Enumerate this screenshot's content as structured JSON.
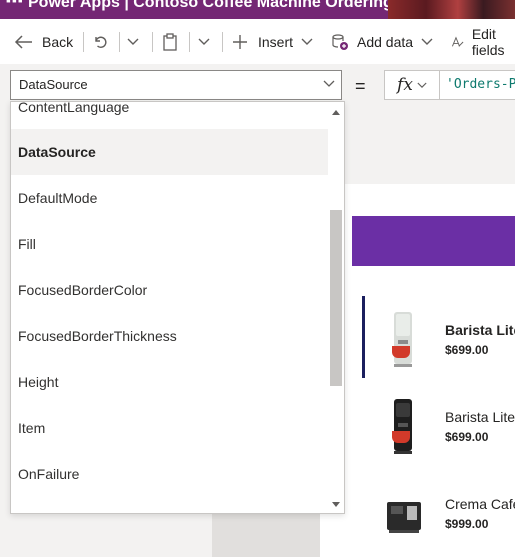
{
  "titlebar": {
    "title": "Power Apps | Contoso Coffee Machine Ordering"
  },
  "commandbar": {
    "back_label": "Back",
    "insert_label": "Insert",
    "add_data_label": "Add data",
    "edit_fields_label": "Edit fields"
  },
  "formulabar": {
    "property": "DataSource",
    "equals": "=",
    "fx_label": "fx",
    "formula": "'Orders-Products'"
  },
  "dropdown": {
    "options": [
      "ContentLanguage",
      "DataSource",
      "DefaultMode",
      "Fill",
      "FocusedBorderColor",
      "FocusedBorderThickness",
      "Height",
      "Item",
      "OnFailure"
    ],
    "selected": "DataSource"
  },
  "app_preview": {
    "products": [
      {
        "name": "Barista Lite",
        "price": "$699.00"
      },
      {
        "name": "Barista Lite",
        "price": "$699.00"
      },
      {
        "name": "Crema Cafe",
        "price": "$999.00"
      }
    ]
  },
  "colors": {
    "brand": "#742774",
    "banner": "#6b2fa5",
    "selected_bar": "#1b1f5e"
  }
}
